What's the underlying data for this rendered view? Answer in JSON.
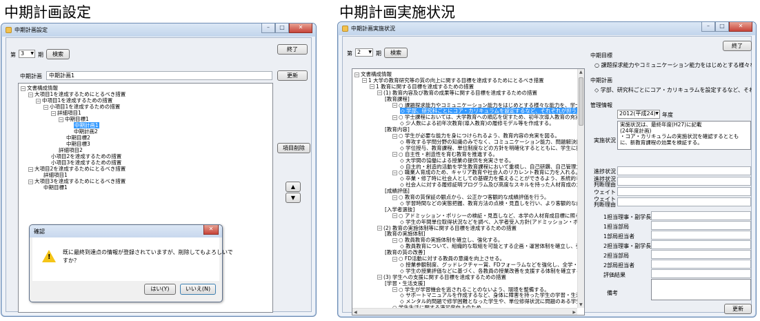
{
  "headings": {
    "left": "中期計画設定",
    "right": "中期計画実施状況"
  },
  "left_window": {
    "title": "中期計画設定",
    "term_prefix": "第",
    "term_value": "3",
    "term_suffix": "期",
    "search_label": "検索",
    "exit_label": "終了",
    "plan_label": "中期計画",
    "plan_value": "中期計画1",
    "update_label": "更新",
    "delete_item_label": "項目削除",
    "up_arrow": "▲",
    "down_arrow": "▼",
    "tree": [
      "文書構成情報",
      "大項目1を達成するためにとるべき措置",
      "中項目1を達成するための措置",
      "小項目1を達成するための措置",
      "詳細項目1",
      "中期目標1",
      "中期計画1",
      "中期計画2",
      "中期目標2",
      "中期目標3",
      "詳細項目2",
      "小項目2を達成するための措置",
      "小項目3を達成するための措置",
      "大項目2を達成するためにとるべき措置",
      "詳細項目1",
      "大項目3を達成するためにとるべき措置",
      "中期目標1"
    ],
    "dialog": {
      "title": "確認",
      "message_line1": "既に最終到達点の情報が登録されていますが、削除してもよろしいで",
      "message_line2": "すか？",
      "yes_label": "はい(Y)",
      "no_label": "いいえ(N)"
    }
  },
  "right_window": {
    "title": "中期計画実施状況",
    "term_prefix": "第",
    "term_value": "2",
    "term_suffix": "期",
    "search_label": "検索",
    "exit_label": "終了",
    "goal_heading": "中期目標",
    "goal_text": "○ 課題探求能力やコミュニケーション能力をはじめとする様々な能力を、学士",
    "plan_heading": "中期計画",
    "plan_text": "◇ 学部、研究科ごとにコア・カリキュラムを設定するなど、それぞれが担う人材",
    "management_heading": "管理情報",
    "year_value": "2012(平成24)",
    "year_suffix": "年度",
    "status_label": "実施状況",
    "status_text": "実施状況は、最終年度(H27)に記載\n(24年度計画)\n・コア・カリキュラムの実施状況を確認するとともに、新教育課程の効果を検証する。",
    "field_labels": [
      "進捗状況",
      "進捗状況\n判断理由",
      "ウェイト",
      "ウェイト\n判断理由"
    ],
    "person_labels": [
      "1担当理事・副学長",
      "1担当部局",
      "1部局担当者",
      "2担当理事・副学長",
      "2担当部局",
      "2部局担当者",
      "評価結果"
    ],
    "remarks_label": "備考",
    "update_label": "更新",
    "tree": [
      "文書構成情報",
      "1 大学の教育研究等の質の向上に関する目標を達成するためにとるべき措置",
      "1 教育に関する目標を達成するための措置",
      "(1) 教育内容及び教育の成果等に関する目標を達成するための措置",
      "[教育課程]",
      "○ 課題探求能力やコミュニケーション能力をはじめとする様々な能力を、学士、修士、博士",
      "◇ 学部、研究科ごとにコア・カリキュラムを設定するなど、それぞれが担う人材育成",
      "○ 学士課程においては、大学教育への順応を促すため、初年次導入教育の充実を図る。",
      "◇ 少人数による初年次教育(導入教育)の履修モデル等を作成する。",
      "[教育内容]",
      "○ 学生が必要な能力を身につけられるよう、教育内容の充実を図る。",
      "◇ 専攻する学問分野の知識のみでなく、コミュニケーション能力、問題解決能力、情報",
      "◇ 学位授与、教育課程、単位制度などの方針を明確化するとともに、学生に提供する",
      "○ 自主性・創造性を育む教育を推進する。",
      "◇ 大学間の協働による授業の提供を充実させる。",
      "◇ 自主的・創造的活動を学生教育課程において重視し、自己研鑽、自己管理力、協調",
      "○ 職業人育成のため、キャリア教育や社会人のリカレント教育に力を入れる。",
      "◇ 卒業・修了時に社会人としての基礎力を備えることができるよう、系統的なキャリア教育を",
      "◇ 社会人に対する履修証明プログラム及び高度なスキルを持った人材育成のための",
      "[成績評価]",
      "○ 教育の質保証の観点から、公正かつ客観的な成績評価を行う。",
      "◇ 学習時間などの実態把握、教育方法の点検・見直しを行い、より客観的な成績評",
      "[入学者選抜]",
      "○ アドミッション・ポリシーの検証・見直しなど、本学の人材育成目標に照らし適切な人材の",
      "◇ 学生の年間単位取得状況などを調べ、入学者受入方針(アドミッション・ポリシー)と",
      "(2) 教育の実施体制等に関する目標を達成するための措置",
      "[教育の実施体制]",
      "○ 教員教育の実施体制を確立し、強化する。",
      "◇ 教員教育について、組織的な取組を可能とする企画・運営体制を確立し、強化する",
      "[教育の質の改善]",
      "○ FD活動に対する教員の意識を向上させる。",
      "◇ 授業参観制度、グッドレクチャー賞、FDフォーラムなどを強化し、全学・各学部及び",
      "◇ 学生の授業評価などに基づく、各教員の授業改善を支援する体制を確立するとともに",
      "(3) 学生への支援に関する目標を達成するための措置",
      "[学習・生活支援]",
      "○ 学生が学習機会を逃されることのないよう、環境を整備する。",
      "◇ サポートマニュアルを作成するなど、身体に障害を持った学生の学習・生活面での支",
      "◇ メンタル的問題で修学困難となった学生や、単位修得状況に問題のある学生、留学",
      "○ 学生生活に関する満足度向上のため"
    ]
  },
  "icons": {
    "warning": "warning-icon",
    "minimize": "minimize-icon",
    "maximize": "maximize-icon",
    "close": "close-icon"
  },
  "colors": {
    "selection": "#3399ff",
    "titlebar": "#c2d5ec",
    "close": "#c7443a"
  }
}
